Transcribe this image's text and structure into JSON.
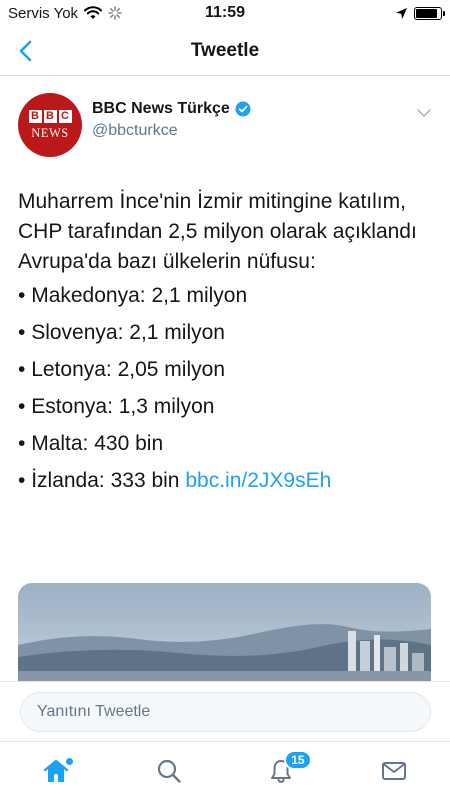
{
  "status_bar": {
    "carrier": "Servis Yok",
    "time": "11:59",
    "battery_level": 0.9
  },
  "nav": {
    "title": "Tweetle",
    "back_icon": "chevron-left-icon"
  },
  "tweet": {
    "author_name": "BBC News Türkçe",
    "author_handle": "@bbcturkce",
    "avatar": {
      "logo_letters": [
        "B",
        "B",
        "C"
      ],
      "logo_word": "NEWS",
      "bg_color": "#bb1919"
    },
    "verified": true,
    "body": {
      "paragraph_1": "Muharrem İnce'nin İzmir mitingine katılım, CHP tarafından 2,5 milyon olarak açıklandı",
      "paragraph_2": "Avrupa'da bazı ülkelerin nüfusu:",
      "bullet_symbol": "•",
      "bullets": [
        "Makedonya: 2,1 milyon",
        "Slovenya: 2,1 milyon",
        "Letonya: 2,05 milyon",
        "Estonya: 1,3 milyon",
        "Malta: 430 bin",
        "İzlanda: 333 bin"
      ],
      "link_text": "bbc.in/2JX9sEh"
    }
  },
  "reply": {
    "placeholder": "Yanıtını Tweetle"
  },
  "tab_bar": {
    "items": [
      {
        "name": "home",
        "icon": "home-icon",
        "active": true
      },
      {
        "name": "search",
        "icon": "search-icon",
        "active": false
      },
      {
        "name": "notifications",
        "icon": "bell-icon",
        "badge": "15",
        "active": false
      },
      {
        "name": "messages",
        "icon": "mail-icon",
        "active": false
      }
    ]
  },
  "colors": {
    "accent": "#1da1f2",
    "text": "#14171a",
    "secondary_text": "#657786",
    "divider": "#e1e8ed"
  }
}
